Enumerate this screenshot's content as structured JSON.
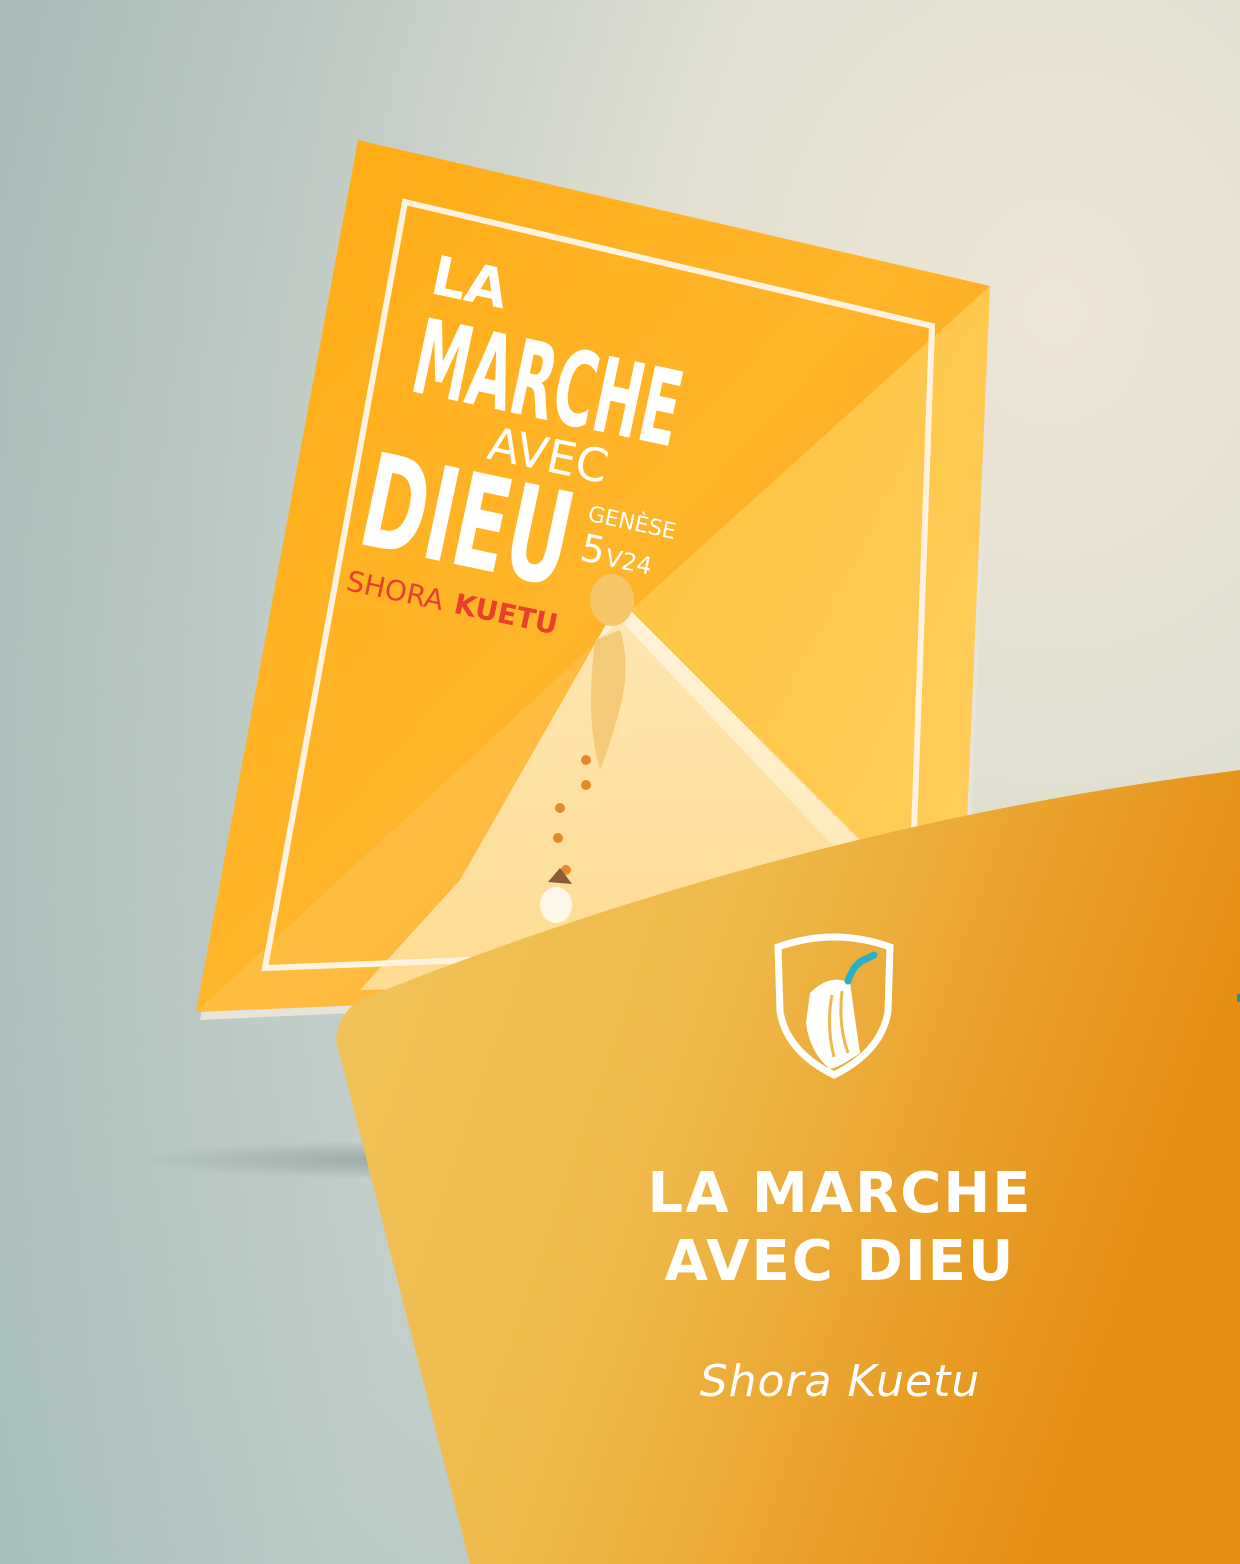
{
  "cover": {
    "word_la": "LA",
    "word_marche": "MARCHE",
    "word_avec": "AVEC",
    "word_dieu": "DIEU",
    "reference_book": "GENÈSE",
    "reference_chapter": "5",
    "reference_verse": "V24",
    "author_first": "SHORA",
    "author_last": "KUETU"
  },
  "panel": {
    "title_line1": "LA MARCHE",
    "title_line2": "AVEC DIEU",
    "author": "Shora Kuetu"
  },
  "colors": {
    "cover_orange": "#ffa20e",
    "panel_gold": "#f0b84a",
    "panel_orange": "#e38a10",
    "author_red": "#e8402a",
    "emblem_blue": "#28b0c8"
  },
  "icons": {
    "emblem": "shield-shofar-icon"
  }
}
